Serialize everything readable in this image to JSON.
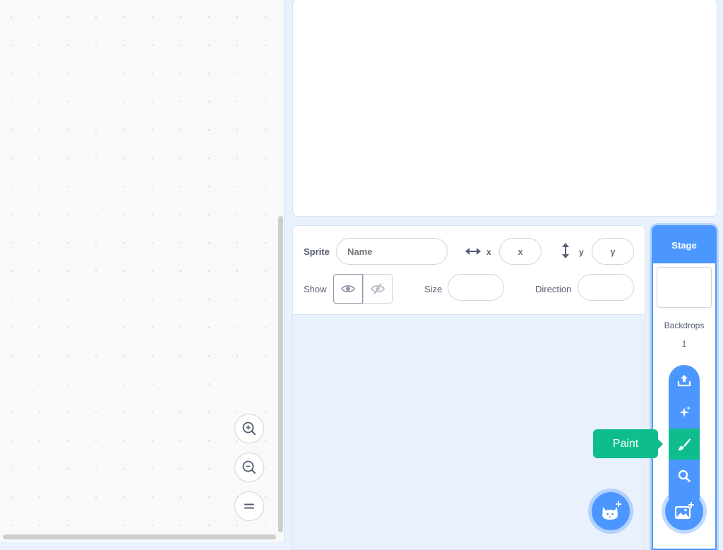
{
  "sprite_info": {
    "sprite_label": "Sprite",
    "name_placeholder": "Name",
    "x_label": "x",
    "x_placeholder": "x",
    "y_label": "y",
    "y_placeholder": "y",
    "show_label": "Show",
    "size_label": "Size",
    "size_value": "",
    "direction_label": "Direction",
    "direction_value": ""
  },
  "stage_selector": {
    "header": "Stage",
    "backdrops_label": "Backdrops",
    "backdrops_count": "1"
  },
  "backdrop_menu": {
    "items": [
      {
        "icon": "upload-icon"
      },
      {
        "icon": "surprise-icon"
      },
      {
        "icon": "paint-icon",
        "active": true
      },
      {
        "icon": "search-icon"
      }
    ],
    "tooltip": "Paint"
  },
  "colors": {
    "accent": "#4c97ff",
    "paint_green": "#0fbd8c",
    "text": "#575e75",
    "pane_bg": "#e9f1fc"
  }
}
